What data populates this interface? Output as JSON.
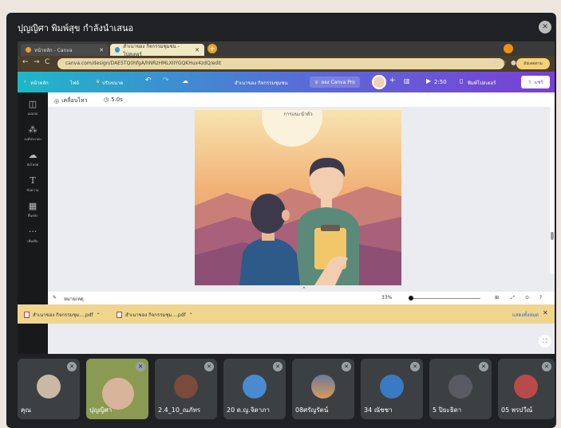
{
  "meeting": {
    "presenter_label": "ปุญญิศา พิมพ์สุข กำลังนำเสนอ"
  },
  "browser": {
    "tabs": [
      {
        "label": "หน้าหลัก - Canva"
      },
      {
        "label": "สำเนาของ กิจกรรมชุมชน - โปสเตอร์"
      }
    ],
    "url": "canva.com/design/DAE5TQ0hfgA/hNRzHMLXIIYGQKHux4zdQ/edit",
    "update_label": "อัปเดตตาม"
  },
  "canva": {
    "home_label": "หน้าหลัก",
    "file_label": "ไฟล์",
    "resize_label": "ปรับขนาด",
    "doc_title": "สำเนาของ กิจกรรมชุมชน",
    "try_pro_label": "ลอง Canva Pro",
    "play_time": "2:50",
    "print_label": "พิมพ์โปสเตอร์",
    "share_label": "แชร์",
    "sidebar": [
      {
        "label": "แม่แบบ",
        "icon": "template-icon"
      },
      {
        "label": "องค์ประกอบ",
        "icon": "elements-icon"
      },
      {
        "label": "อัปโหลด",
        "icon": "upload-icon"
      },
      {
        "label": "ข้อความ",
        "icon": "text-icon"
      },
      {
        "label": "พื้นหลัง",
        "icon": "background-icon"
      },
      {
        "label": "เพิ่มเติม",
        "icon": "more-icon"
      }
    ],
    "animate_label": "เคลื่อนไหว",
    "timer": "5.0s",
    "slide_caption": "การแนะนำตัว",
    "notes_label": "หมายเหตุ",
    "zoom": "33%"
  },
  "downloads": {
    "items": [
      {
        "name": "สำเนาของ กิจกรรมชุม....pdf"
      },
      {
        "name": "สำเนาของ กิจกรรมชุม....pdf"
      }
    ],
    "show_all_label": "แสดงทั้งหมด"
  },
  "participants": [
    {
      "name": "คุณ"
    },
    {
      "name": "ปุญญิศา"
    },
    {
      "name": "2.4_10_ณภัทร"
    },
    {
      "name": "20 ด.ญ.จิดาภา"
    },
    {
      "name": "08ศรัญรัตน์"
    },
    {
      "name": "34 ณัชชา"
    },
    {
      "name": "5 ปิยะธิดา"
    },
    {
      "name": "05 พรปวีณ์"
    }
  ]
}
